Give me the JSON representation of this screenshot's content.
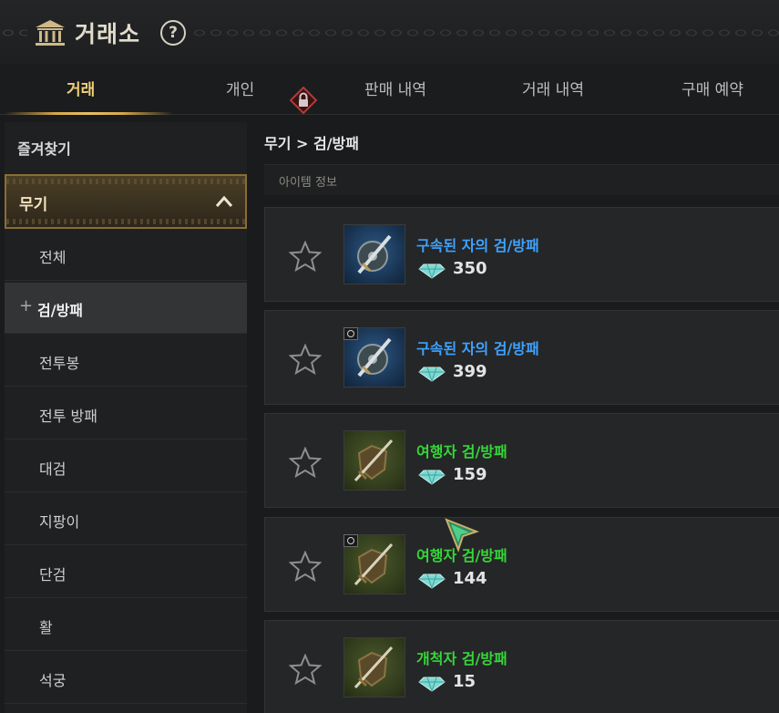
{
  "window": {
    "title": "거래소",
    "help_icon": "?"
  },
  "tabs": [
    {
      "label": "거래",
      "active": true
    },
    {
      "label": "개인",
      "locked": true
    },
    {
      "label": "판매 내역"
    },
    {
      "label": "거래 내역"
    },
    {
      "label": "구매 예약"
    }
  ],
  "sidebar": {
    "favorites": "즐겨찾기",
    "category": "무기",
    "items": [
      {
        "label": "전체"
      },
      {
        "label": "검/방패",
        "active": true,
        "prefix": "+"
      },
      {
        "label": "전투봉"
      },
      {
        "label": "전투 방패"
      },
      {
        "label": "대검"
      },
      {
        "label": "지팡이"
      },
      {
        "label": "단검"
      },
      {
        "label": "활"
      },
      {
        "label": "석궁"
      }
    ]
  },
  "breadcrumb": "무기 > 검/방패",
  "list_header": "아이템 정보",
  "listings": [
    {
      "name": "구속된 자의 검/방패",
      "price": "350",
      "rarity_color": "#3fa2ff",
      "icon": "sword-shield-icon"
    },
    {
      "name": "구속된 자의 검/방패",
      "price": "399",
      "rarity_color": "#3fa2ff",
      "icon": "sword-shield-icon"
    },
    {
      "name": "여행자 검/방패",
      "price": "159",
      "rarity_color": "#36d63a",
      "icon": "sword-shield-icon"
    },
    {
      "name": "여행자 검/방패",
      "price": "144",
      "rarity_color": "#36d63a",
      "icon": "sword-shield-icon"
    },
    {
      "name": "개척자 검/방패",
      "price": "15",
      "rarity_color": "#36d63a",
      "icon": "sword-shield-icon"
    }
  ]
}
